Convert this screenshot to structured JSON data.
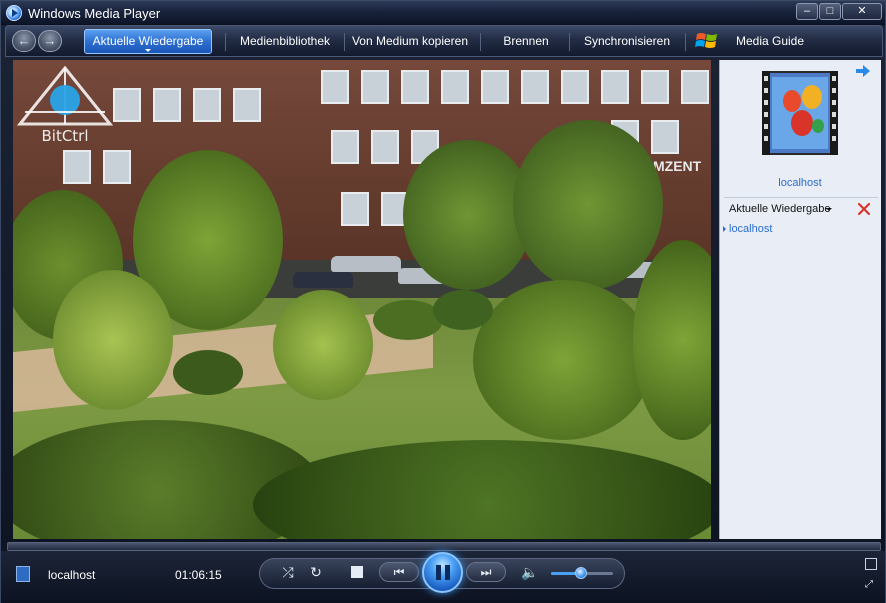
{
  "window": {
    "title": "Windows Media Player"
  },
  "navigation": {
    "tabs": [
      {
        "label": "Aktuelle Wiedergabe",
        "active": true
      },
      {
        "label": "Medienbibliothek"
      },
      {
        "label": "Von Medium kopieren"
      },
      {
        "label": "Brennen"
      },
      {
        "label": "Synchronisieren"
      },
      {
        "label": "Media Guide"
      }
    ]
  },
  "video": {
    "watermark": "BitCtrl",
    "building_sign": "MZENT"
  },
  "sidepane": {
    "title": "localhost",
    "playlist_header": "Aktuelle Wiedergabe",
    "playlist_items": [
      "localhost"
    ]
  },
  "player": {
    "now_playing": "localhost",
    "elapsed_time": "01:06:15",
    "state": "playing",
    "volume_fraction": 0.48
  },
  "colors": {
    "accent": "#2e6fd0",
    "link": "#2a6ccf"
  },
  "icons": [
    "app-icon",
    "back-icon",
    "forward-icon",
    "windows-logo",
    "album-art-icon",
    "forward-pane-icon",
    "clear-list-icon",
    "shuffle-icon",
    "repeat-icon",
    "stop-icon",
    "previous-icon",
    "pause-icon",
    "next-icon",
    "speaker-icon"
  ]
}
